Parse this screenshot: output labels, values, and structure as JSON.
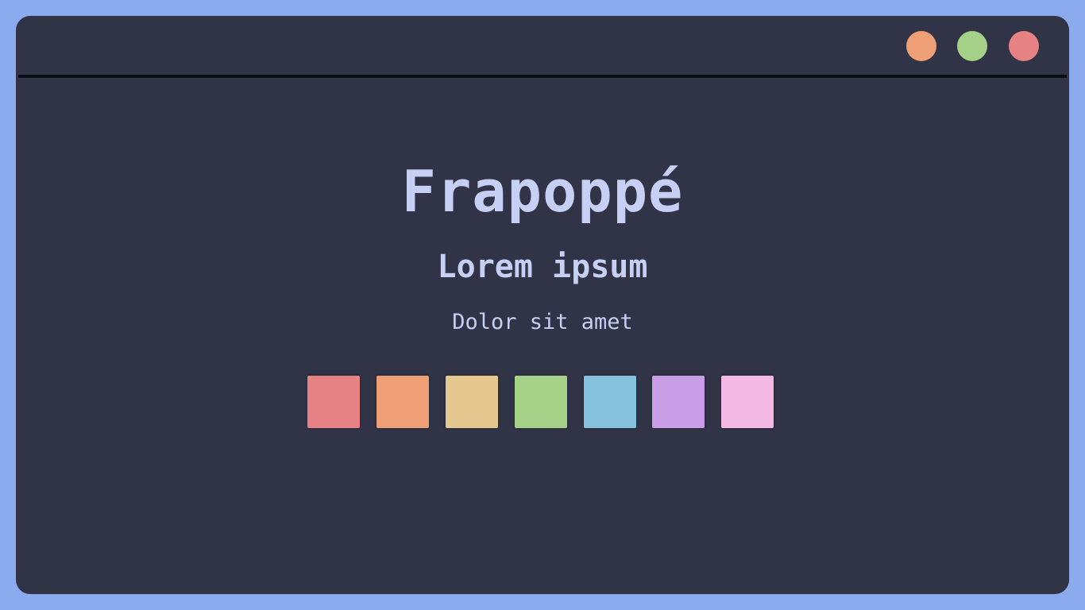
{
  "window": {
    "controls": [
      {
        "name": "window-control-orange",
        "color": "#ef9f76"
      },
      {
        "name": "window-control-green",
        "color": "#a6d189"
      },
      {
        "name": "window-control-red",
        "color": "#e78284"
      }
    ]
  },
  "main": {
    "title": "Frapoppé",
    "subtitle": "Lorem ipsum",
    "tagline": "Dolor sit amet"
  },
  "palette": {
    "swatches": [
      {
        "name": "red",
        "color": "#e78284"
      },
      {
        "name": "peach",
        "color": "#ef9f76"
      },
      {
        "name": "yellow",
        "color": "#e5c890"
      },
      {
        "name": "green",
        "color": "#a6d189"
      },
      {
        "name": "sapphire",
        "color": "#85c1dc"
      },
      {
        "name": "mauve",
        "color": "#ca9ee6"
      },
      {
        "name": "pink",
        "color": "#f4b8e4"
      }
    ]
  },
  "colors": {
    "frame": "#8caaee",
    "background": "#303446",
    "text": "#c6d0f5"
  }
}
